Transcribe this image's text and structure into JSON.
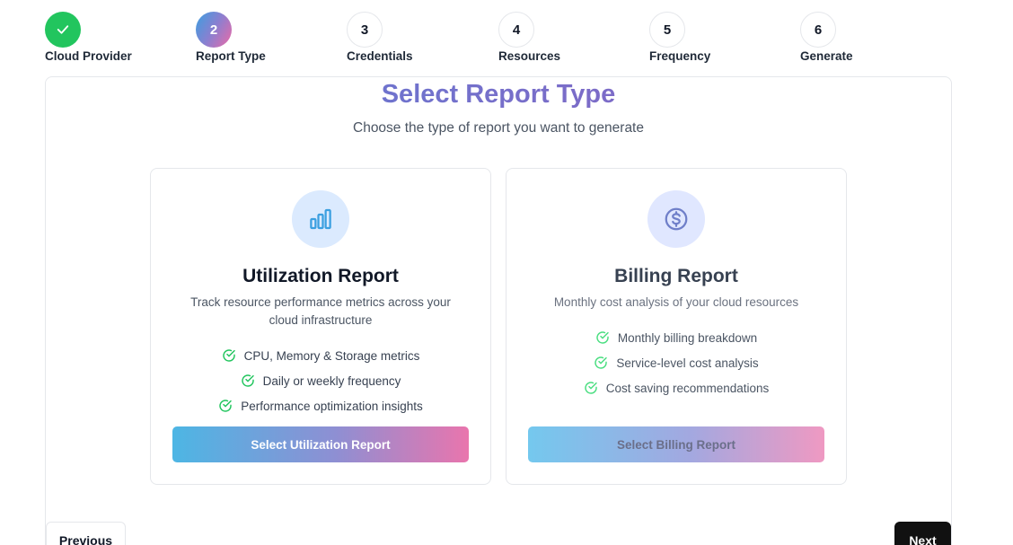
{
  "stepper": {
    "steps": [
      {
        "number": "",
        "label": "Cloud Provider",
        "state": "completed",
        "icon": "check-icon"
      },
      {
        "number": "2",
        "label": "Report Type",
        "state": "active"
      },
      {
        "number": "3",
        "label": "Credentials",
        "state": "pending"
      },
      {
        "number": "4",
        "label": "Resources",
        "state": "pending"
      },
      {
        "number": "5",
        "label": "Frequency",
        "state": "pending"
      },
      {
        "number": "6",
        "label": "Generate",
        "state": "pending"
      }
    ]
  },
  "main": {
    "title": "Select Report Type",
    "subtitle": "Choose the type of report you want to generate",
    "cards": [
      {
        "icon": "bar-chart-icon",
        "title": "Utilization Report",
        "description": "Track resource performance metrics across your cloud infrastructure",
        "features": [
          "CPU, Memory & Storage metrics",
          "Daily or weekly frequency",
          "Performance optimization insights"
        ],
        "button_label": "Select Utilization Report"
      },
      {
        "icon": "dollar-icon",
        "title": "Billing Report",
        "description": "Monthly cost analysis of your cloud resources",
        "features": [
          "Monthly billing breakdown",
          "Service-level cost analysis",
          "Cost saving recommendations"
        ],
        "button_label": "Select Billing Report"
      }
    ]
  },
  "footer": {
    "previous_label": "Previous",
    "next_label": "Next"
  },
  "colors": {
    "completed": "#22c55e",
    "check": "#22c55e",
    "next_button": "#111111"
  }
}
